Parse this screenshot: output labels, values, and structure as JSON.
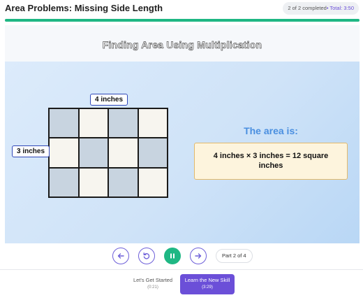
{
  "header": {
    "title": "Area Problems: Missing Side Length",
    "completed_text": "2 of 2 completed",
    "total_text": "• Total: 3:50"
  },
  "progress": {
    "fraction": 1.0,
    "color": "#1fb784"
  },
  "slide": {
    "title": "Finding Area Using Multiplication",
    "grid": {
      "columns": 4,
      "rows": 3,
      "pattern": [
        [
          1,
          0,
          1,
          0
        ],
        [
          0,
          1,
          0,
          1
        ],
        [
          1,
          0,
          1,
          0
        ]
      ]
    },
    "top_label": "4 inches",
    "left_label": "3 inches",
    "area_heading": "The area is:",
    "equation": "4 inches × 3 inches = 12 square inches"
  },
  "controls": {
    "prev_icon": "arrow-left-icon",
    "replay_icon": "replay-icon",
    "pause_icon": "pause-icon",
    "next_icon": "arrow-right-icon",
    "part_text": "Part 2 of 4"
  },
  "chapters": [
    {
      "name": "Let's Get Started",
      "time": "(0:21)",
      "active": false
    },
    {
      "name": "Learn the New Skill",
      "time": "(3:29)",
      "active": true
    }
  ],
  "colors": {
    "accent": "#6b4fd8",
    "success": "#1fb784",
    "heading": "#4a8fe0"
  }
}
